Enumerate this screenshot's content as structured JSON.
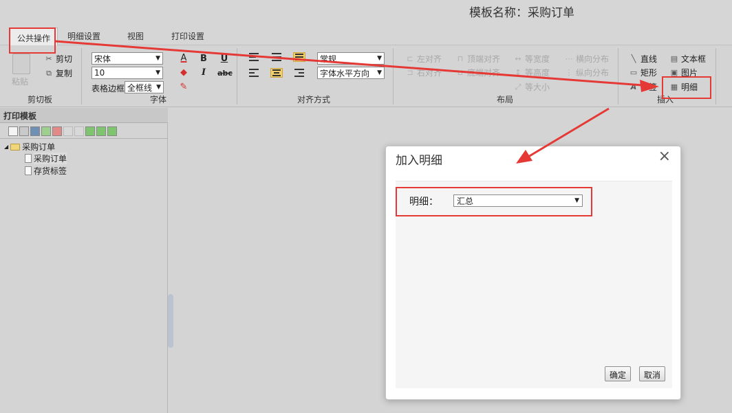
{
  "window": {
    "title": "模板名称：采购订单"
  },
  "tabs": [
    "公共操作",
    "明细设置",
    "视图",
    "打印设置"
  ],
  "ribbon": {
    "clipboard": {
      "label": "剪切板",
      "paste": "粘贴",
      "cut": "剪切",
      "copy": "复制"
    },
    "font": {
      "label": "字体",
      "family": "宋体",
      "size": "10",
      "border_label": "表格边框",
      "border_value": "全框线",
      "bold": "B",
      "italic": "I",
      "underline": "U",
      "strike": "abc",
      "font_color": "A"
    },
    "align": {
      "label": "对齐方式",
      "style_value": "常规",
      "horizontal_value": "字体水平方向"
    },
    "layout": {
      "label": "布局",
      "left": "左对齐",
      "right": "右对齐",
      "top": "顶端对齐",
      "bottom": "底端对齐",
      "equal_width": "等宽度",
      "equal_height": "等高度",
      "equal_size": "等大小",
      "h_dist": "横向分布",
      "v_dist": "纵向分布"
    },
    "insert": {
      "label": "插入",
      "line": "直线",
      "rect": "矩形",
      "label_item": "标签",
      "textbox": "文本框",
      "image": "图片",
      "detail": "明细"
    }
  },
  "left_panel": {
    "header": "打印模板",
    "tree": {
      "root": "采购订单",
      "children": [
        "采购订单",
        "存货标签"
      ]
    }
  },
  "dialog": {
    "title": "加入明细",
    "close_icon": "×",
    "field_label": "明细：",
    "field_value": "汇总",
    "ok": "确定",
    "cancel": "取消"
  },
  "colors": {
    "annotation": "#e53935",
    "highlight": "#f3cf6a"
  }
}
